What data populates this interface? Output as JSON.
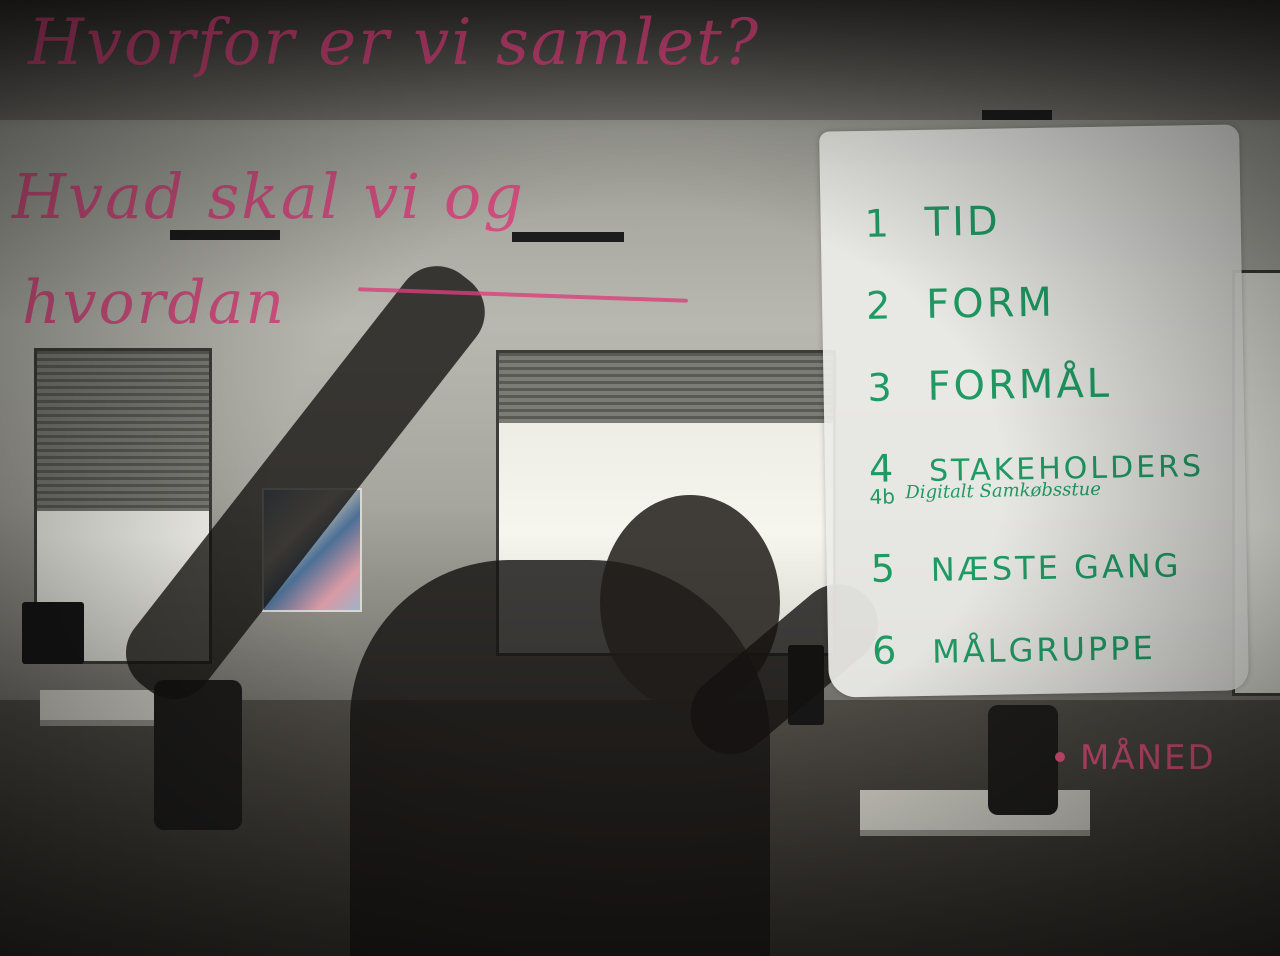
{
  "glass_writing": {
    "line1": "Hvorfor er vi samlet?",
    "line2": "Hvad skal vi og",
    "line3": "hvordan",
    "side_note": "MÅNED"
  },
  "paper": {
    "items": [
      {
        "num": "1",
        "text": "TID"
      },
      {
        "num": "2",
        "text": "FORM"
      },
      {
        "num": "3",
        "text": "FORMÅL"
      },
      {
        "num": "4",
        "text": "STAKEHOLDERS"
      },
      {
        "num": "5",
        "text": "NÆSTE GANG"
      },
      {
        "num": "6",
        "text": "MÅLGRUPPE"
      }
    ],
    "sub_item": {
      "num": "4b",
      "text": "Digitalt Samkøbsstue"
    }
  },
  "colors": {
    "marker_pink": "#d9407a",
    "marker_green": "#1f9a63"
  }
}
